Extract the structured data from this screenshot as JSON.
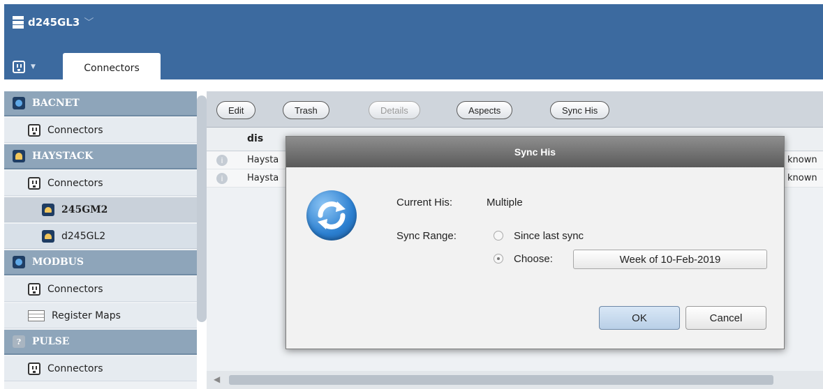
{
  "header": {
    "project_title": "d245GL3",
    "app_menu_icon": "outlet-icon",
    "active_tab": "Connectors"
  },
  "sidebar": {
    "groups": [
      {
        "label": "BACNET",
        "items": [
          "Connectors"
        ]
      },
      {
        "label": "HAYSTACK",
        "items": [
          "Connectors"
        ],
        "connectors": [
          "245GM2",
          "d245GL2"
        ],
        "selected": "245GM2"
      },
      {
        "label": "MODBUS",
        "items": [
          "Connectors",
          "Register Maps"
        ]
      },
      {
        "label": "PULSE",
        "items": [
          "Connectors"
        ]
      }
    ]
  },
  "toolbar": {
    "edit": "Edit",
    "trash": "Trash",
    "details": "Details",
    "aspects": "Aspects",
    "sync_his": "Sync His"
  },
  "grid": {
    "header_dis": "dis",
    "rows": [
      {
        "dis": "Haysta",
        "right": "known"
      },
      {
        "dis": "Haysta",
        "right": "known"
      }
    ]
  },
  "dialog": {
    "title": "Sync His",
    "current_his_label": "Current His:",
    "current_his_value": "Multiple",
    "sync_range_label": "Sync Range:",
    "option_since_last": "Since last sync",
    "option_choose": "Choose:",
    "choose_value": "Week of 10-Feb-2019",
    "selected_option": "choose",
    "ok": "OK",
    "cancel": "Cancel"
  },
  "colors": {
    "header_bg": "#3c6a9f",
    "sidebar_group_bg": "#8ea5ba",
    "dialog_title_bg": "#5a5a5a",
    "ok_button_bg": "#c9dcef"
  }
}
